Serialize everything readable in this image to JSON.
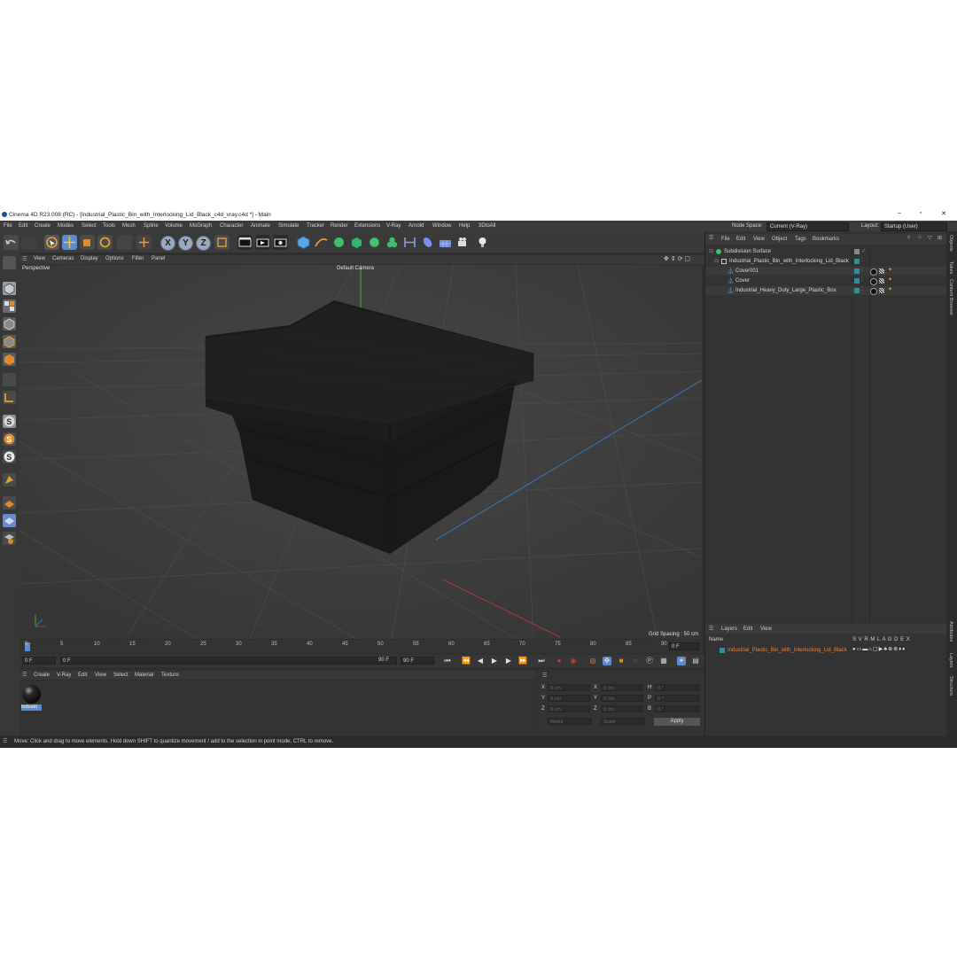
{
  "window": {
    "title": "Cinema 4D R23.008 (RC) - [Industrial_Plastic_Bin_with_Interlocking_Lid_Black_c4d_vray.c4d *] - Main",
    "minimize": "–",
    "maximize": "▫",
    "close": "✕"
  },
  "menu": {
    "items": [
      "File",
      "Edit",
      "Create",
      "Modes",
      "Select",
      "Tools",
      "Mesh",
      "Spline",
      "Volume",
      "MoGraph",
      "Character",
      "Animate",
      "Simulate",
      "Tracker",
      "Render",
      "Extensions",
      "V-Ray",
      "Arnold",
      "Window",
      "Help",
      "3DtoAll"
    ],
    "node_space_label": "Node Space:",
    "node_space_value": "Current (V-Ray)",
    "layout_label": "Layout:",
    "layout_value": "Startup (User)"
  },
  "toolbar": {
    "axis_x": "X",
    "axis_y": "Y",
    "axis_z": "Z"
  },
  "viewport": {
    "menu": [
      "View",
      "Cameras",
      "Display",
      "Options",
      "Filter",
      "Panel"
    ],
    "view_name": "Perspective",
    "camera": "Default Camera",
    "grid_spacing": "Grid Spacing : 50 cm"
  },
  "timeline": {
    "ticks": [
      "0",
      "5",
      "10",
      "15",
      "20",
      "25",
      "30",
      "35",
      "40",
      "45",
      "50",
      "55",
      "60",
      "65",
      "70",
      "75",
      "80",
      "85",
      "90"
    ],
    "current_frame": "0 F",
    "start_frame": "0 F",
    "range_start": "0 F",
    "range_end": "90 F",
    "end_frame": "90 F",
    "end_frame2": "0 F"
  },
  "material_manager": {
    "menu": [
      "Create",
      "V-Ray",
      "Edit",
      "View",
      "Select",
      "Material",
      "Texture"
    ],
    "material_name": "Industri"
  },
  "coordinates": {
    "x_pos": "0 cm",
    "y_pos": "0 cm",
    "z_pos": "0 cm",
    "x_size": "0 cm",
    "y_size": "0 cm",
    "z_size": "0 cm",
    "h_rot": "0 °",
    "p_rot": "0 °",
    "b_rot": "0 °",
    "labels": {
      "x": "X",
      "y": "Y",
      "z": "Z",
      "h": "H",
      "p": "P",
      "b": "B"
    },
    "space": "World",
    "mode": "Scale",
    "apply": "Apply"
  },
  "object_manager": {
    "menu": [
      "File",
      "Edit",
      "View",
      "Object",
      "Tags",
      "Bookmarks"
    ],
    "objects": [
      {
        "name": "Subdivision Surface"
      },
      {
        "name": "Industrial_Plastic_Bin_with_Interlocking_Lid_Black"
      },
      {
        "name": "Cover001"
      },
      {
        "name": "Cover"
      },
      {
        "name": "Industrial_Heavy_Duty_Large_Plastic_Box"
      }
    ]
  },
  "layer_manager": {
    "menu": [
      "Layers",
      "Edit",
      "View"
    ],
    "col_name": "Name",
    "col_flags": "S V R M L A G D E X",
    "layer_name": "Industrial_Plastic_Bin_with_Interlocking_Lid_Black"
  },
  "side_tabs": [
    "Objects",
    "Takes",
    "Content Browser",
    "Attributes",
    "Layers",
    "Structure"
  ],
  "status": "Move: Click and drag to move elements. Hold down SHIFT to quantize movement / add to the selection in point mode, CTRL to remove.",
  "colors": {
    "accent": "#5c8ccf",
    "bg": "#2f2f2f",
    "layer_orange": "#e8823a"
  }
}
